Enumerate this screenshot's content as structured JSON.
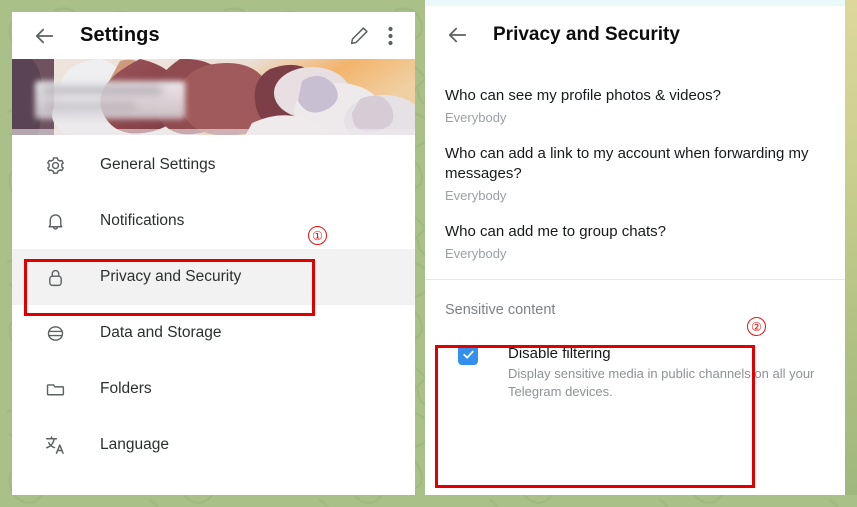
{
  "background": {
    "color": "#a9c189",
    "pattern": "telegram-doodle-pattern"
  },
  "left_window": {
    "header": {
      "back_icon": "back-arrow-icon",
      "title": "Settings",
      "edit_icon": "pencil-icon",
      "menu_icon": "three-dots-vertical-icon"
    },
    "cover": {
      "alt": "profile cover photo",
      "blurred_name": true
    },
    "menu_items": [
      {
        "icon": "gear-icon",
        "label": "General Settings",
        "selected": false
      },
      {
        "icon": "bell-icon",
        "label": "Notifications",
        "selected": false
      },
      {
        "icon": "lock-icon",
        "label": "Privacy and Security",
        "selected": true
      },
      {
        "icon": "database-icon",
        "label": "Data and Storage",
        "selected": false
      },
      {
        "icon": "folder-icon",
        "label": "Folders",
        "selected": false
      },
      {
        "icon": "translate-icon",
        "label": "Language",
        "selected": false
      }
    ]
  },
  "right_window": {
    "header": {
      "back_icon": "back-arrow-icon",
      "title": "Privacy and Security"
    },
    "privacy_rows": [
      {
        "question": "Who can see my profile photos & videos?",
        "value": "Everybody"
      },
      {
        "question": "Who can add a link to my account when forwarding my messages?",
        "value": "Everybody"
      },
      {
        "question": "Who can add me to group chats?",
        "value": "Everybody"
      }
    ],
    "sensitive": {
      "section_title": "Sensitive content",
      "checkbox_checked": true,
      "checkbox_icon": "checkmark-icon",
      "option_title": "Disable filtering",
      "option_description": "Display sensitive media in public channels on all your Telegram devices."
    }
  },
  "annotations": {
    "accent_color": "#e00000",
    "marker_1": "①",
    "marker_2": "②"
  }
}
